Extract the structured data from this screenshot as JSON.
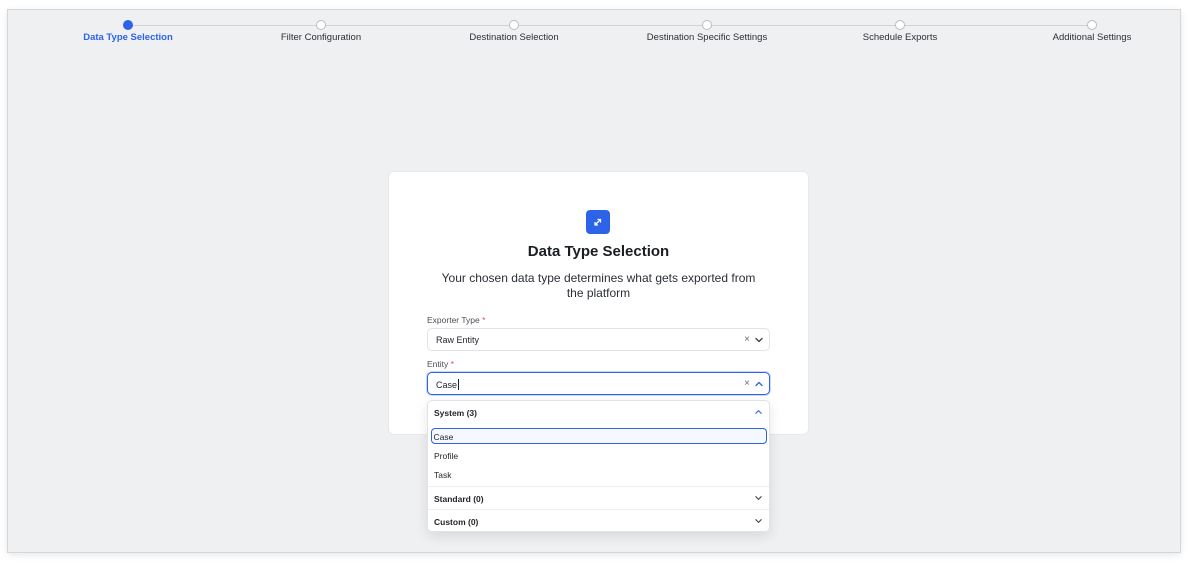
{
  "stepper": {
    "steps": [
      {
        "label": "Data Type Selection",
        "active": true
      },
      {
        "label": "Filter Configuration",
        "active": false
      },
      {
        "label": "Destination Selection",
        "active": false
      },
      {
        "label": "Destination Specific Settings",
        "active": false
      },
      {
        "label": "Schedule Exports",
        "active": false
      },
      {
        "label": "Additional Settings",
        "active": false
      }
    ]
  },
  "card": {
    "icon": "arrows-exchange-icon",
    "title": "Data Type Selection",
    "description": "Your chosen data type determines what gets exported from the platform"
  },
  "form": {
    "exporter_type": {
      "label": "Exporter Type",
      "required_mark": "*",
      "value": "Raw Entity",
      "clear_icon": "×"
    },
    "entity": {
      "label": "Entity",
      "required_mark": "*",
      "value": "Case",
      "clear_icon": "×"
    }
  },
  "dropdown": {
    "groups": [
      {
        "label": "System (3)",
        "expanded": true
      },
      {
        "label": "Standard (0)",
        "expanded": false
      },
      {
        "label": "Custom (0)",
        "expanded": false
      }
    ],
    "options": [
      "Case",
      "Profile",
      "Task"
    ],
    "selected": "Case"
  },
  "colors": {
    "accent": "#2d63e8",
    "required": "#e5484d",
    "background": "#eff0f2"
  }
}
